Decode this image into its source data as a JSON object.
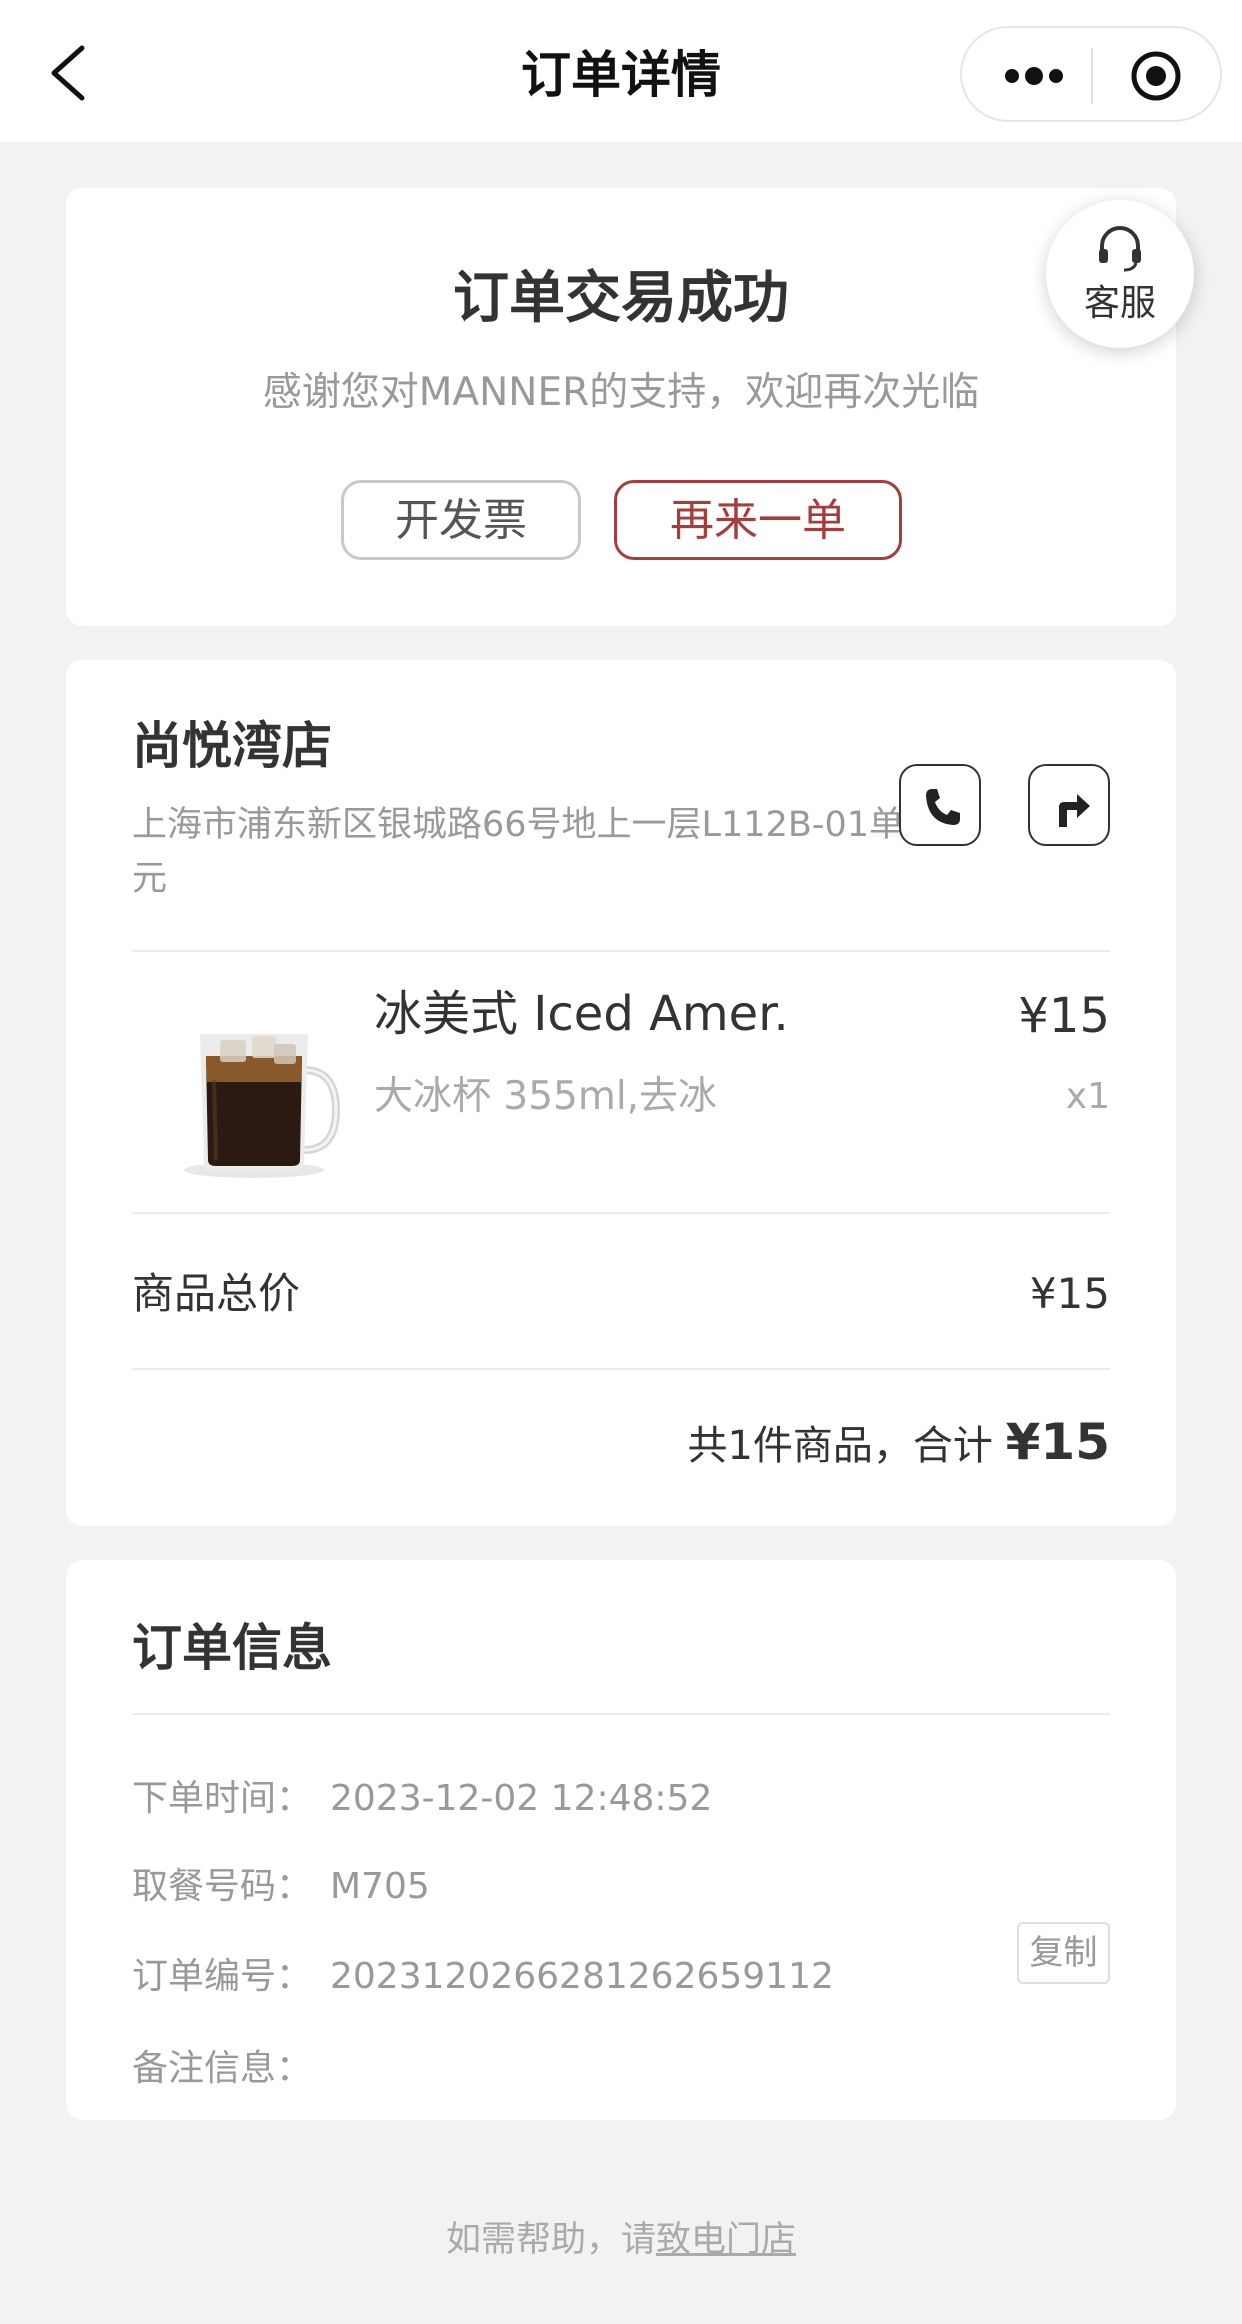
{
  "navbar": {
    "title": "订单详情",
    "back_icon": "chevron-left-icon",
    "more_icon": "more-dots-icon",
    "close_icon": "target-circle-icon"
  },
  "status_card": {
    "title": "订单交易成功",
    "subtitle": "感谢您对MANNER的支持，欢迎再次光临",
    "invoice_label": "开发票",
    "reorder_label": "再来一单",
    "service_label": "客服",
    "accent_color": "#a83c3c"
  },
  "store": {
    "name": "尚悦湾店",
    "address": "上海市浦东新区银城路66号地上一层L112B-01单元",
    "phone_icon": "phone-icon",
    "navigate_icon": "direction-arrow-icon"
  },
  "items": [
    {
      "name": "冰美式 Iced Amer.",
      "spec": "大冰杯 355ml,去冰",
      "price": "¥15",
      "qty": "x1"
    }
  ],
  "summary": {
    "subtotal_label": "商品总价",
    "subtotal_value": "¥15",
    "total_prefix": "共1件商品，合计",
    "total_amount": "¥15"
  },
  "order_info": {
    "title": "订单信息",
    "rows": [
      {
        "label": "下单时间：",
        "value": "2023-12-02 12:48:52"
      },
      {
        "label": "取餐号码：",
        "value": "M705"
      },
      {
        "label": "订单编号：",
        "value": "2023120266281262659112"
      },
      {
        "label": "备注信息：",
        "value": ""
      }
    ],
    "copy_label": "复制"
  },
  "footer": {
    "prefix": "如需帮助，请",
    "link": "致电门店"
  }
}
